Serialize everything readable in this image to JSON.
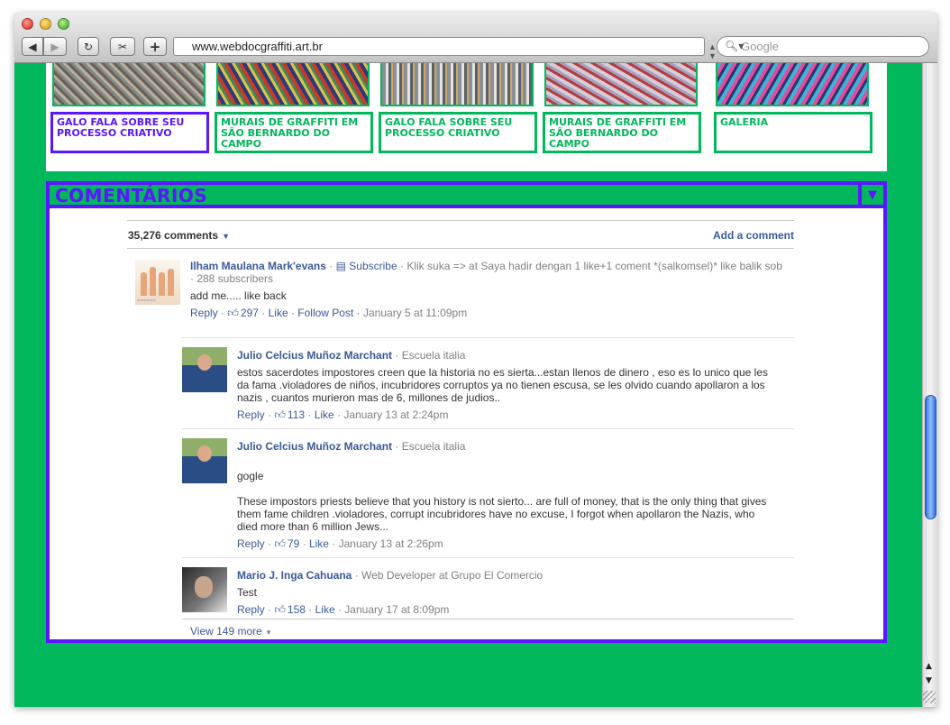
{
  "browser": {
    "url": "www.webdocgraffiti.art.br",
    "search_placeholder": "Google"
  },
  "gallery": {
    "cards": [
      {
        "label": "GALO FALA SOBRE SEU PROCESSO CRIATIVO"
      },
      {
        "label": "MURAIS DE GRAFFITI EM SÃO BERNARDO DO CAMPO"
      },
      {
        "label": "GALO FALA SOBRE SEU PROCESSO CRIATIVO"
      },
      {
        "label": "MURAIS DE GRAFFITI EM SÃO BERNARDO DO CAMPO"
      },
      {
        "label": "GALERIA"
      }
    ]
  },
  "comments": {
    "title": "COMENTÁRIOS",
    "count_label": "35,276 comments",
    "add_comment": "Add a comment",
    "items": [
      {
        "author": "Ilham Maulana Mark'evans",
        "subscribe": "Subscribe",
        "headline": "· Klik suka => at Saya hadir dengan 1 like+1 coment *(salkomsel)* like balik sob",
        "subscribers": "· 288 subscribers",
        "text": "add me..... like back",
        "reply": "Reply",
        "likes": "297",
        "like": "Like",
        "follow": "Follow Post",
        "date": "January 5 at 11:09pm"
      },
      {
        "author": "Julio Celcius Muñoz Marchant",
        "meta": "· Escuela italia",
        "text": "estos sacerdotes impostores creen que la historia no es sierta...estan llenos de dinero , eso es lo unico que les da fama .violadores de niños, incubridores corruptos ya no tienen escusa, se les olvido cuando apollaron a los nazis , cuantos murieron mas de 6, millones de judios..",
        "reply": "Reply",
        "likes": "113",
        "like": "Like",
        "date": "January 13 at 2:24pm"
      },
      {
        "author": "Julio Celcius Muñoz Marchant",
        "meta": "· Escuela italia",
        "text1": "gogle",
        "text2": "These impostors priests believe that you history is not sierto... are full of money, that is the only thing that gives them fame children .violadores, corrupt incubridores have no excuse, I forgot when apollaron the Nazis, who died more than 6 million Jews...",
        "reply": "Reply",
        "likes": "79",
        "like": "Like",
        "date": "January 13 at 2:26pm"
      },
      {
        "author": "Mario J. Inga Cahuana",
        "meta": "· Web Developer at Grupo El Comercio",
        "text": "Test",
        "reply": "Reply",
        "likes": "158",
        "like": "Like",
        "date": "January 17 at 8:09pm"
      }
    ],
    "view_more": "View 149 more"
  },
  "colors": {
    "page_green": "#01b85c",
    "accent_purple": "#5a16ff",
    "fb_blue": "#3b5998"
  },
  "icons": [
    "back-arrow-icon",
    "forward-arrow-icon",
    "reload-icon",
    "snip-icon",
    "add-tab-icon",
    "search-icon",
    "rss-icon",
    "thumbs-up-icon",
    "chevron-down-icon"
  ]
}
